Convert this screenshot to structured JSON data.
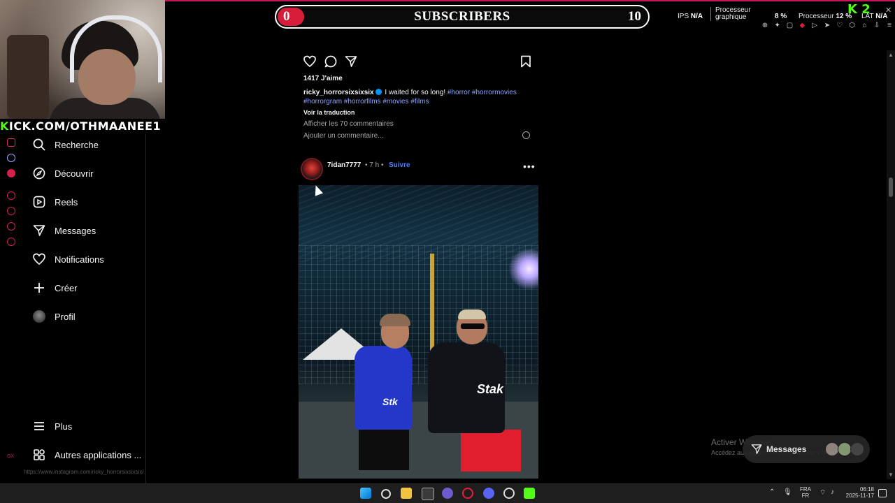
{
  "stream_overlay": {
    "kick_url_highlight": "K",
    "kick_url_rest": "ICK.COM/OTHMAANEE1",
    "subscribers": {
      "current": "0",
      "label": "SUBSCRIBERS",
      "goal": "10",
      "progress_fraction": 0.0
    },
    "stats": {
      "ips_label": "IPS",
      "ips_value": "N/A",
      "gpu_label": "Processeur graphique",
      "gpu_value": "8 %",
      "cpu_label": "Processeur",
      "cpu_value": "12 %",
      "lat_label": "LAT",
      "lat_value": "N/A"
    },
    "k2_badge": "K 2",
    "close_glyph": "✕"
  },
  "sidebar": {
    "items": [
      {
        "label": "Recherche",
        "icon": "search-icon"
      },
      {
        "label": "Découvrir",
        "icon": "compass-icon"
      },
      {
        "label": "Reels",
        "icon": "reels-icon"
      },
      {
        "label": "Messages",
        "icon": "send-icon"
      },
      {
        "label": "Notifications",
        "icon": "heart-icon"
      },
      {
        "label": "Créer",
        "icon": "plus-icon"
      },
      {
        "label": "Profil",
        "icon": "avatar"
      },
      {
        "label": "Plus",
        "icon": "menu-icon"
      },
      {
        "label": "Autres applications ...",
        "icon": "apps-icon"
      }
    ]
  },
  "post1": {
    "likes": "1417 J'aime",
    "username": "ricky_horrorsixsixsix",
    "caption_text": "I waited for so long!",
    "hashtags_line1": "#horror #horrormovies",
    "hashtags_line2": "#horrorgram #horrorfilms #movies #films",
    "translate": "Voir la traduction",
    "view_comments": "Afficher les 70 commentaires",
    "add_comment_placeholder": "Ajouter un commentaire..."
  },
  "post2": {
    "username": "7idan7777",
    "time": "• 7 h •",
    "follow": "Suivre",
    "more": "•••",
    "jersey_text_1": "Stk",
    "jersey_text_2": "Stak"
  },
  "status_url": "https://www.instagram.com/ricky_horrorsixsixsix/",
  "windows_activation": {
    "title": "Activer Windows",
    "subtitle": "Accédez aux paramètres pour activer Windows."
  },
  "messages_pill": {
    "label": "Messages"
  },
  "taskbar": {
    "lang_top": "FRA",
    "lang_bottom": "FR",
    "time": "06:18",
    "date": "2025-11-17"
  },
  "colors": {
    "accent_red": "#d81d3b",
    "kick_green": "#53fc18",
    "instagram_link": "#8da4ff",
    "follow_blue": "#4c7dff"
  }
}
